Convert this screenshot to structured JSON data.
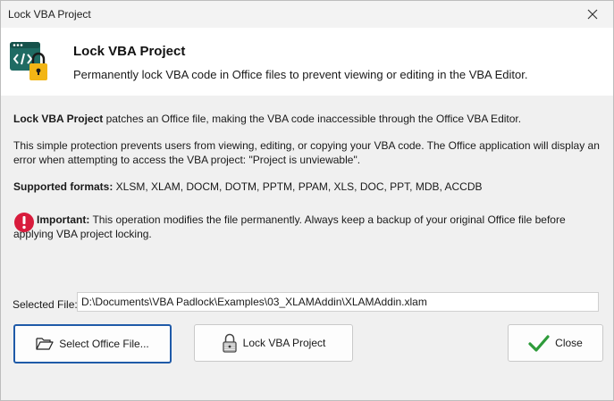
{
  "window": {
    "title": "Lock VBA Project"
  },
  "header": {
    "title": "Lock VBA Project",
    "subtitle": "Permanently lock VBA code in Office files to prevent viewing or editing in the VBA Editor."
  },
  "content": {
    "intro_bold": "Lock VBA Project",
    "intro_rest": " patches an Office file, making the VBA code inaccessible through the Office VBA Editor.",
    "protection": "This simple protection prevents users from viewing, editing, or copying your VBA code. The Office application will display an error when attempting to access the VBA project: \"Project is unviewable\".",
    "formats_label": "Supported formats:",
    "formats_value": " XLSM, XLAM, DOCM, DOTM, PPTM, PPAM, XLS, DOC, PPT, MDB, ACCDB",
    "important_label": "Important:",
    "important_line1": " This operation modifies the file permanently. Always keep a backup of your original Office file before",
    "important_line2": "applying VBA project locking."
  },
  "file": {
    "label": "Selected File:",
    "value": "D:\\Documents\\VBA Padlock\\Examples\\03_XLAMAddin\\XLAMAddin.xlam"
  },
  "buttons": {
    "select": "Select Office File...",
    "lock": "Lock VBA Project",
    "close": "Close"
  },
  "icons": {
    "app": "lock-code-icon",
    "warning": "exclamation-icon",
    "folder": "folder-open-icon",
    "padlock": "padlock-icon",
    "check": "check-icon",
    "close": "close-icon"
  },
  "colors": {
    "accent": "#1f5aa8",
    "icon_teal": "#1f6b63",
    "lock_yellow": "#f2b515",
    "warning_red": "#d81b3c",
    "check_green": "#2e9b3a"
  }
}
